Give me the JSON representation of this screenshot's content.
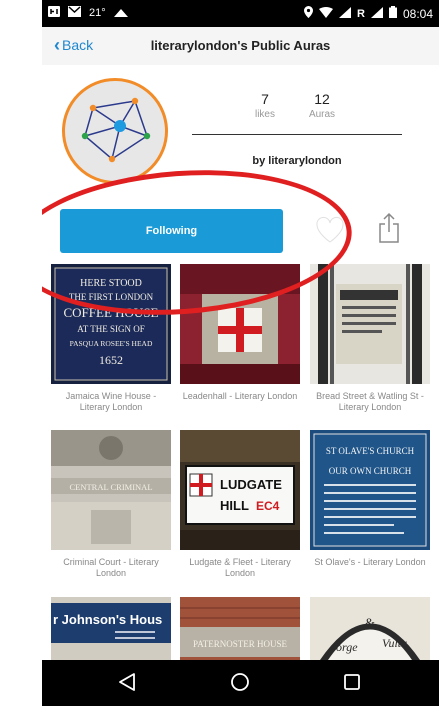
{
  "status_bar": {
    "temperature": "21°",
    "time": "08:04",
    "signal_label": "R"
  },
  "header": {
    "back_label": "Back",
    "title": "literarylondon's Public Auras"
  },
  "profile": {
    "likes_count": "7",
    "likes_label": "likes",
    "auras_count": "12",
    "auras_label": "Auras",
    "byline": "by literarylondon"
  },
  "actions": {
    "follow_label": "Following"
  },
  "grid": [
    {
      "caption": "Jamaica Wine House - Literary London",
      "plaque_lines": [
        "HERE STOOD",
        "THE FIRST LONDON",
        "COFFEE HOUSE",
        "AT THE SIGN OF",
        "PASQUA ROSEE'S HEAD",
        "1652"
      ]
    },
    {
      "caption": "Leadenhall - Literary London"
    },
    {
      "caption": "Bread Street & Watling St - Literary London"
    },
    {
      "caption": "Criminal Court - Literary London",
      "plaque_lines": [
        "CENTRAL CRIMINAL"
      ]
    },
    {
      "caption": "Ludgate & Fleet - Literary London",
      "plaque_lines": [
        "LUDGATE",
        "HILL",
        "EC4"
      ]
    },
    {
      "caption": "St Olave's - Literary London",
      "plaque_lines": [
        "ST OLAVE'S CHURCH",
        "OUR OWN CHURCH"
      ]
    },
    {
      "caption": "",
      "plaque_lines": [
        "r Johnson's Hous"
      ]
    },
    {
      "caption": "",
      "plaque_lines": [
        "PATERNOSTER HOUSE"
      ]
    },
    {
      "caption": "",
      "plaque_lines": [
        "orge",
        "&",
        "Vultu"
      ]
    }
  ],
  "colors": {
    "accent": "#1a9bd7",
    "annotation": "#e02020",
    "link": "#1e88d0"
  }
}
